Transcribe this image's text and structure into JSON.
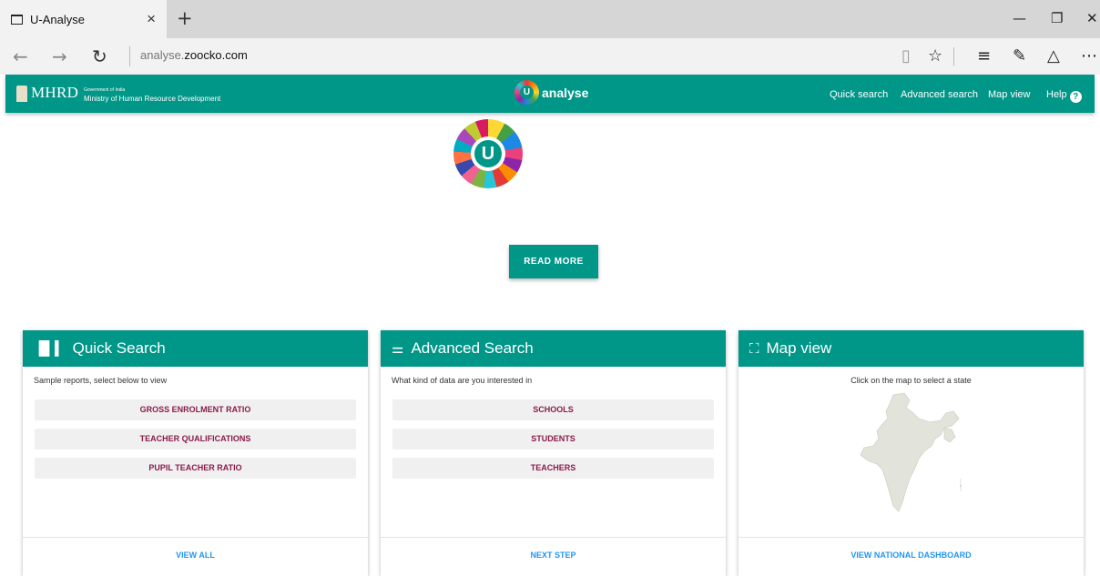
{
  "browser": {
    "tab_title": "U-Analyse",
    "tab_close": "×",
    "new_tab": "+",
    "url_domain": "analyse.",
    "url_host": "zoocko.com",
    "window_minimize": "—",
    "window_restore": "❐",
    "window_close": "✕"
  },
  "header": {
    "org_abbrev": "MHRD",
    "gov_line": "Government of India",
    "ministry_line": "Ministry of Human Resource Development",
    "brand": "analyse",
    "nav": [
      "Quick search",
      "Advanced search",
      "Map view",
      "Help"
    ],
    "help_badge": "?"
  },
  "hero": {
    "logo_letter": "U",
    "read_more": "READ MORE"
  },
  "cards": {
    "quick": {
      "title": "Quick Search",
      "description": "Sample reports, select below to view",
      "options": [
        "GROSS ENROLMENT RATIO",
        "TEACHER QUALIFICATIONS",
        "PUPIL TEACHER RATIO"
      ],
      "footer": "VIEW ALL"
    },
    "advanced": {
      "title": "Advanced Search",
      "description": "What kind of data are you interested in",
      "options": [
        "SCHOOLS",
        "STUDENTS",
        "TEACHERS"
      ],
      "footer": "NEXT STEP"
    },
    "map": {
      "title": "Map view",
      "description": "Click on the map to select a state",
      "footer": "VIEW NATIONAL DASHBOARD"
    }
  },
  "colors": {
    "primary": "#009688",
    "option_text": "#8a1c4a",
    "link": "#2196f3"
  }
}
